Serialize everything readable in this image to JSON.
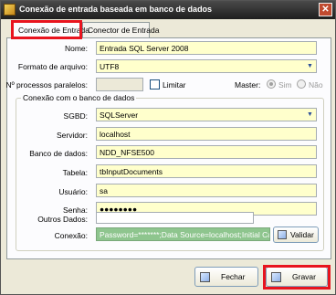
{
  "window": {
    "title": "Conexão de entrada baseada em banco de dados",
    "close_glyph": "✕"
  },
  "tabs": [
    {
      "label": "Conexão de Entrada",
      "active": true
    },
    {
      "label": "Conector de Entrada",
      "active": false
    }
  ],
  "form": {
    "nome": {
      "label": "Nome:",
      "value": "Entrada SQL Server 2008"
    },
    "formato": {
      "label": "Formato de arquivo:",
      "value": "UTF8"
    },
    "processos": {
      "label": "Nº processos paralelos:",
      "value": ""
    },
    "limitar": {
      "label": "Limitar",
      "checked": false
    },
    "master": {
      "label": "Master:",
      "sim": "Sim",
      "nao": "Não",
      "selected": "Sim"
    }
  },
  "db_group": {
    "title": "Conexão com o banco de dados",
    "sgbd": {
      "label": "SGBD:",
      "value": "SQLServer"
    },
    "servidor": {
      "label": "Servidor:",
      "value": "localhost"
    },
    "banco": {
      "label": "Banco de dados:",
      "value": "NDD_NFSE500"
    },
    "tabela": {
      "label": "Tabela:",
      "value": "tbInputDocuments"
    },
    "usuario": {
      "label": "Usuário:",
      "value": "sa"
    },
    "senha": {
      "label": "Senha:",
      "value": "●●●●●●●●"
    },
    "outros": {
      "label": "Outros Dados:",
      "value": ""
    },
    "conexao": {
      "label": "Conexão:",
      "value": "Password=*******;Data Source=localhost;Initial Catalog=N"
    },
    "validar": "Validar"
  },
  "buttons": {
    "fechar": "Fechar",
    "gravar": "Gravar"
  },
  "colors": {
    "highlight": "#e8141e",
    "field_bg": "#ffffcc",
    "connection_bg": "#8ec58e"
  }
}
